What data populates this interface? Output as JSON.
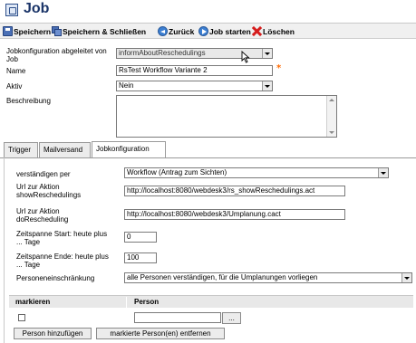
{
  "window": {
    "title": "Job"
  },
  "toolbar": {
    "save": "Speichern",
    "save_close": "Speichern & Schließen",
    "back": "Zurück",
    "start_job": "Job starten",
    "delete": "Löschen"
  },
  "form": {
    "derived_label": "Jobkonfiguration abgeleitet von Job",
    "derived_value": "informAboutReschedulings",
    "name_label": "Name",
    "name_value": "RsTest Workflow Variante 2",
    "active_label": "Aktiv",
    "active_value": "Nein",
    "description_label": "Beschreibung",
    "description_value": ""
  },
  "tabs": [
    {
      "label": "Trigger"
    },
    {
      "label": "Mailversand"
    },
    {
      "label": "Jobkonfiguration"
    }
  ],
  "jobconfig": {
    "notify_label": "verständigen per",
    "notify_value": "Workflow (Antrag zum Sichten)",
    "url_show_label_1": "Url zur Aktion",
    "url_show_label_2": "showReschedulings",
    "url_show_value": "http://localhost:8080/webdesk3/rs_showReschedulings.act",
    "url_do_label_1": "Url zur Aktion",
    "url_do_label_2": "doRescheduling",
    "url_do_value": "http://localhost:8080/webdesk3/Umplanung.cact",
    "start_label_1": "Zeitspanne Start: heute plus",
    "start_label_2": "... Tage",
    "start_value": "0",
    "end_label_1": "Zeitspanne Ende: heute plus",
    "end_label_2": "... Tage",
    "end_value": "100",
    "restriction_label": "Personeneinschränkung",
    "restriction_value": "alle Personen verständigen, für die Umplanungen vorliegen"
  },
  "persons_table": {
    "col_mark": "markieren",
    "col_person": "Person",
    "person_value": "",
    "browse_label": "..."
  },
  "buttons": {
    "add_person": "Person hinzufügen",
    "remove_person": "markierte Person(en) entfernen"
  }
}
